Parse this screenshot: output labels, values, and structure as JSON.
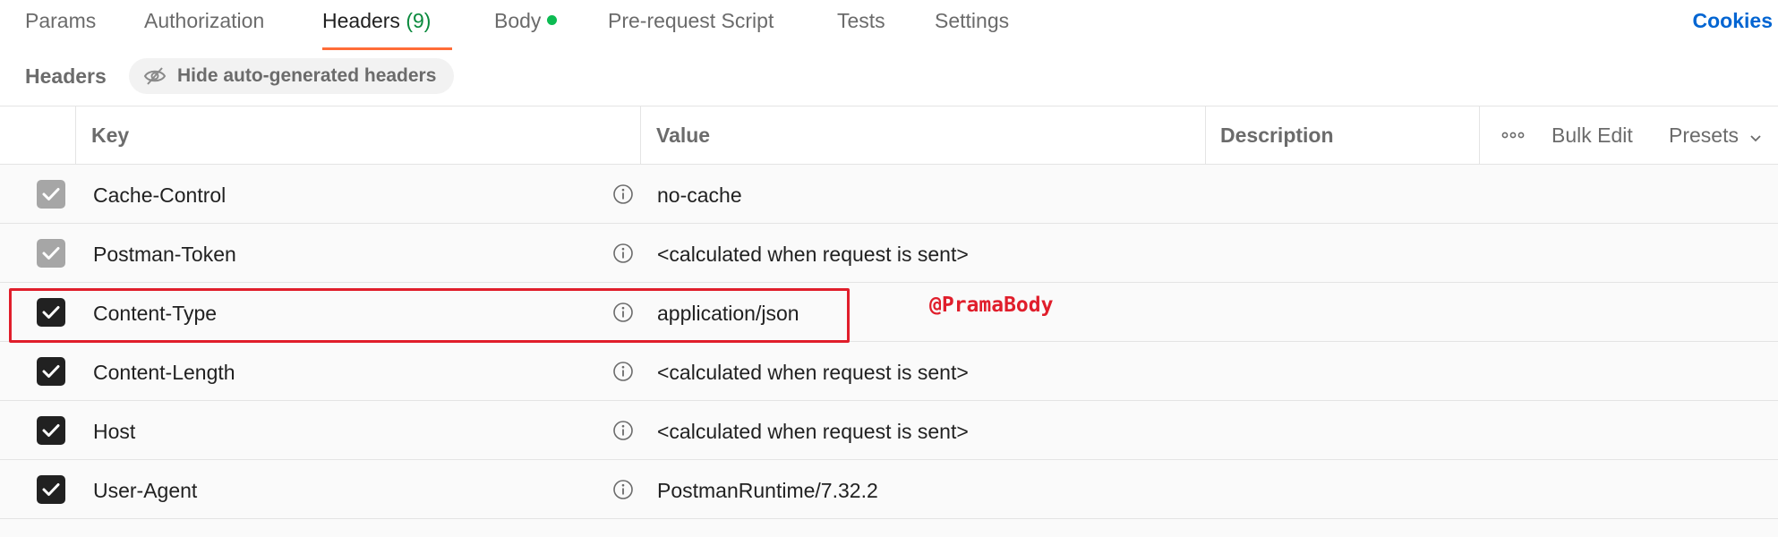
{
  "tabs": [
    {
      "label": "Params"
    },
    {
      "label": "Authorization"
    },
    {
      "label": "Headers",
      "count": "(9)",
      "active": true
    },
    {
      "label": "Body",
      "has_dot": true
    },
    {
      "label": "Pre-request Script"
    },
    {
      "label": "Tests"
    },
    {
      "label": "Settings"
    }
  ],
  "cookies_link": "Cookies",
  "subheader": {
    "title": "Headers",
    "hide_button": "Hide auto-generated headers"
  },
  "table": {
    "columns": {
      "key": "Key",
      "value": "Value",
      "description": "Description"
    },
    "actions": {
      "bulk_edit": "Bulk Edit",
      "presets": "Presets"
    },
    "rows": [
      {
        "key": "Cache-Control",
        "value": "no-cache",
        "checked": true,
        "auto_generated": true
      },
      {
        "key": "Postman-Token",
        "value": "<calculated when request is sent>",
        "checked": true,
        "auto_generated": true
      },
      {
        "key": "Content-Type",
        "value": "application/json",
        "checked": true,
        "auto_generated": false
      },
      {
        "key": "Content-Length",
        "value": "<calculated when request is sent>",
        "checked": true,
        "auto_generated": false
      },
      {
        "key": "Host",
        "value": "<calculated when request is sent>",
        "checked": true,
        "auto_generated": false
      },
      {
        "key": "User-Agent",
        "value": "PostmanRuntime/7.32.2",
        "checked": true,
        "auto_generated": false
      }
    ]
  },
  "annotation": "@PramaBody",
  "colors": {
    "accent_tab_underline": "#ff6c37",
    "link": "#0265d2",
    "annotation_red": "#e01e2b",
    "status_dot": "#0cbb52"
  }
}
